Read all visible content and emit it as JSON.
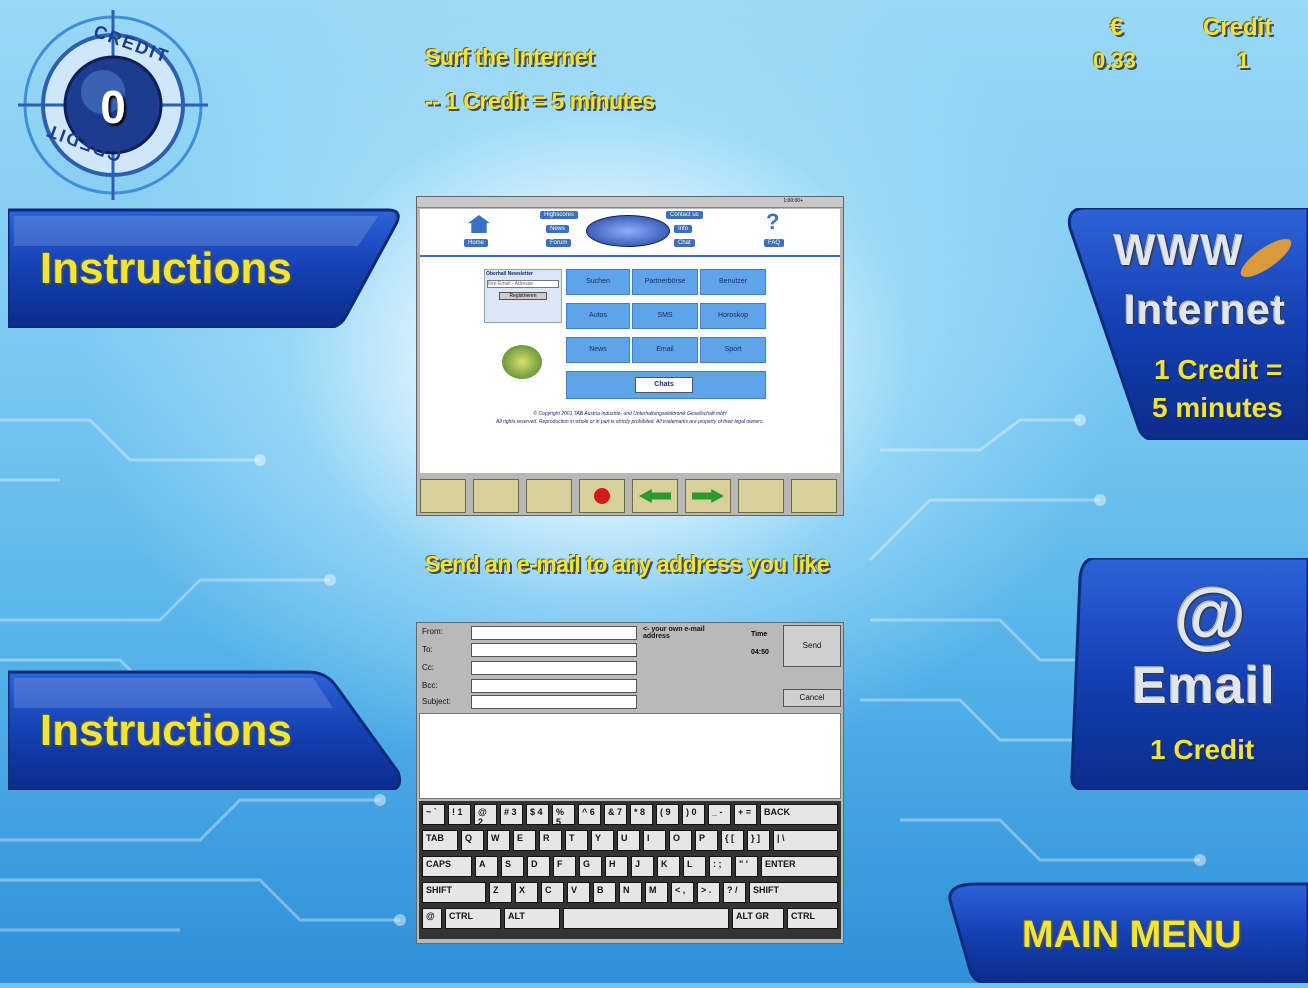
{
  "credit_dial": {
    "value": "0",
    "ring_label_top": "CREDIT",
    "ring_label_bottom": "CREDIT"
  },
  "header": {
    "surf_title": "Surf the Internet",
    "surf_rate": "-- 1 Credit = 5 minutes",
    "euro_label": "€",
    "euro_value": "0.33",
    "credit_label": "Credit",
    "credit_value": "1"
  },
  "instructions_top": {
    "label": "Instructions"
  },
  "instructions_bottom": {
    "label": "Instructions"
  },
  "internet_button": {
    "logo_top": "WWW",
    "logo_bottom": "Internet",
    "line1": "1 Credit =",
    "line2": "5 minutes"
  },
  "email_button": {
    "logo_symbol": "@",
    "logo_text": "Email",
    "line1": "1 Credit"
  },
  "email_heading": "Send an e-mail to any address you like",
  "main_menu": {
    "label": "MAIN MENU"
  },
  "browser_preview": {
    "clock": "1:00:00+",
    "nav_left": [
      "Highscores",
      "News",
      "Forum"
    ],
    "nav_right": [
      "Contact us",
      "Info",
      "Chat"
    ],
    "home_label": "Home",
    "faq_label": "FAQ",
    "newsletter_title": "Oberhall Newsletter",
    "newsletter_placeholder": "Ihre Email - Adresse",
    "register_label": "Registrieren",
    "grid": [
      [
        "Suchen",
        "Partnerbörse",
        "Benutzer"
      ],
      [
        "Autos",
        "SMS",
        "Horoskop"
      ],
      [
        "News",
        "Email",
        "Sport"
      ]
    ],
    "chat_button": "Chats",
    "copyright_line1": "© Copyright 2001 TAB Austria Industrie- und Unterhaltungselektronik Gesellschaft mbH",
    "copyright_line2": "All rights reserved. Reproduction in whole or in part is strictly prohibited. All trademarks are property of their legal owners."
  },
  "mail_preview": {
    "labels": [
      "From:",
      "To:",
      "Cc:",
      "Bcc:",
      "Subject:"
    ],
    "hint": "<- your own e-mail address",
    "time_label": "Time",
    "time_value": "04:50",
    "send_label": "Send",
    "cancel_label": "Cancel"
  },
  "keyboard": {
    "row1": [
      "~ `",
      "! 1",
      "@ 2",
      "# 3",
      "$ 4",
      "% 5",
      "^ 6",
      "& 7",
      "* 8",
      "( 9",
      ") 0",
      "_ -",
      "+ =",
      "BACK"
    ],
    "row2": [
      "TAB",
      "Q",
      "W",
      "E",
      "R",
      "T",
      "Y",
      "U",
      "I",
      "O",
      "P",
      "{ [",
      "} ]",
      "| \\"
    ],
    "row3": [
      "CAPS",
      "A",
      "S",
      "D",
      "F",
      "G",
      "H",
      "J",
      "K",
      "L",
      ": ;",
      "\" '",
      "ENTER"
    ],
    "row4": [
      "SHIFT",
      "Z",
      "X",
      "C",
      "V",
      "B",
      "N",
      "M",
      "< ,",
      "> .",
      "? /",
      "SHIFT"
    ],
    "row5": [
      "@",
      "CTRL",
      "ALT",
      "",
      "ALT GR",
      "CTRL"
    ]
  }
}
